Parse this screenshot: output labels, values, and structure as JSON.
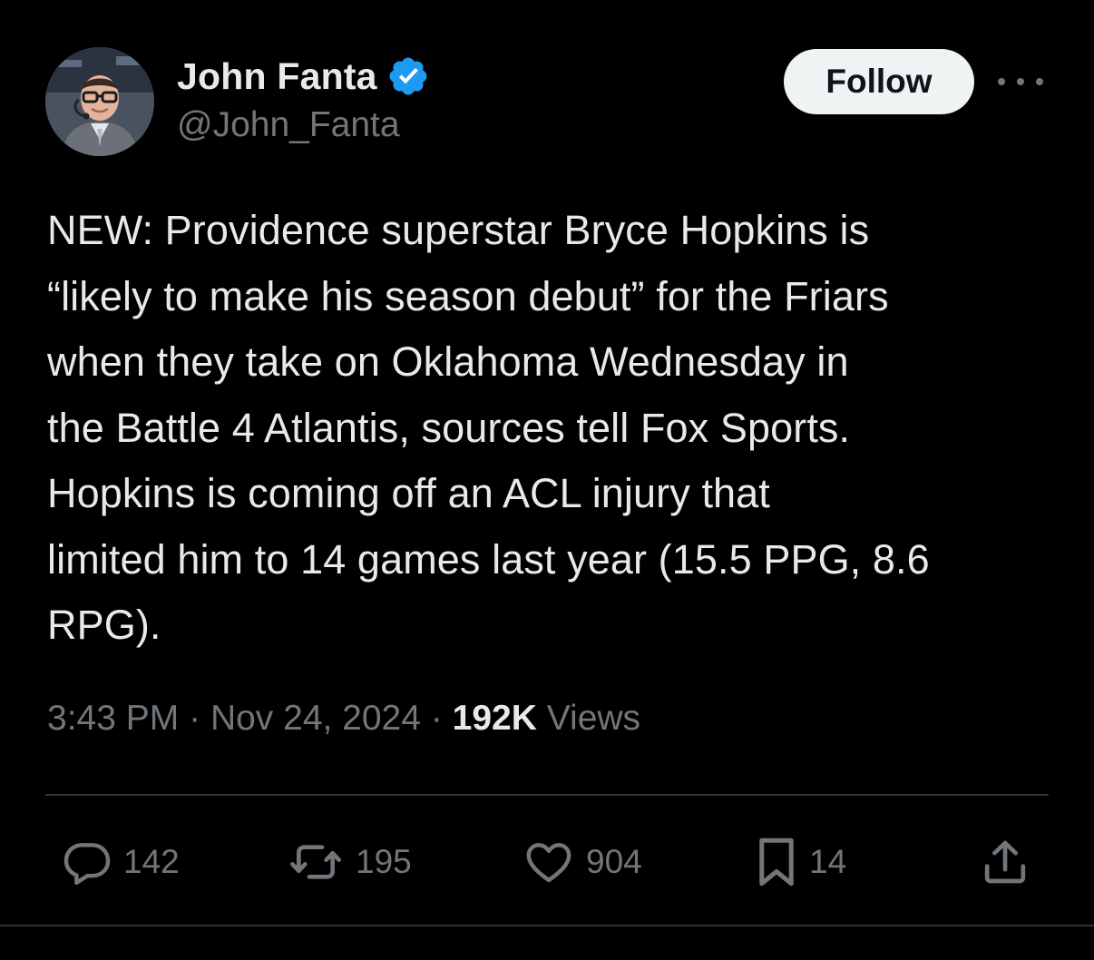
{
  "author": {
    "display_name": "John Fanta",
    "handle": "@John_Fanta",
    "verified_color": "#1d9bf0",
    "avatar_icon": "profile-photo"
  },
  "header": {
    "follow_label": "Follow",
    "more_icon": "ellipsis-icon"
  },
  "tweet": {
    "text": "NEW: Providence superstar Bryce Hopkins is\n“likely to make his season debut” for the Friars\nwhen they take on Oklahoma Wednesday in\nthe Battle 4 Atlantis, sources tell Fox Sports.\nHopkins is coming off an ACL injury that\nlimited him to 14 games last year (15.5 PPG, 8.6\nRPG).",
    "time": "3:43 PM",
    "separator": "·",
    "date": "Nov 24, 2024",
    "views_count": "192K",
    "views_label": "Views"
  },
  "actions": {
    "replies": "142",
    "reposts": "195",
    "likes": "904",
    "bookmarks": "14"
  },
  "colors": {
    "background": "#000000",
    "text": "#e7e9ea",
    "muted": "#71767b",
    "divider": "#2f3336"
  }
}
